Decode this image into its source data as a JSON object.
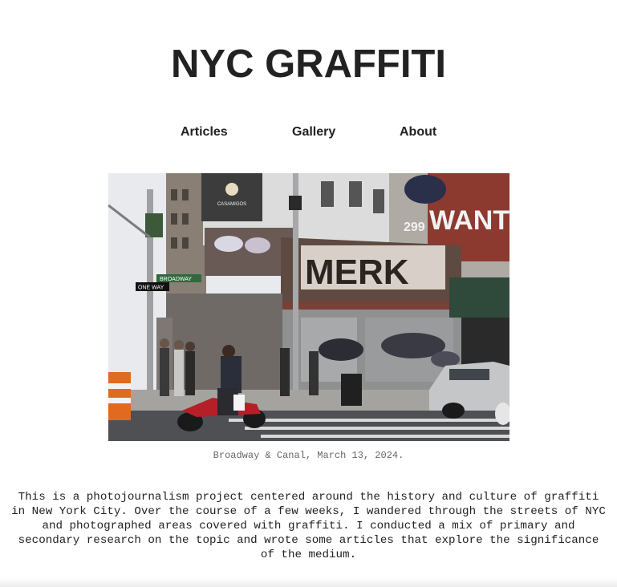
{
  "site": {
    "title": "NYC GRAFFITI"
  },
  "nav": {
    "items": [
      {
        "label": "Articles"
      },
      {
        "label": "Gallery"
      },
      {
        "label": "About"
      }
    ]
  },
  "hero": {
    "photo": {
      "sign_broadway": "BROADWAY",
      "sign_one_way": "ONE WAY",
      "billboard": "CASAMIGOS",
      "tag_main": "MERK",
      "tag_side": "WANT",
      "tag_number": "299"
    },
    "caption": "Broadway & Canal, March 13, 2024."
  },
  "intro": {
    "text": "This is a photojournalism project centered around the history and culture of graffiti in New York City. Over the course of a few weeks, I wandered through the streets of NYC and photographed areas covered with graffiti. I conducted a mix of primary and secondary research on the topic and wrote some articles that explore the significance of the medium."
  },
  "colors": {
    "text": "#222222",
    "caption": "#666666",
    "background": "#ffffff"
  }
}
